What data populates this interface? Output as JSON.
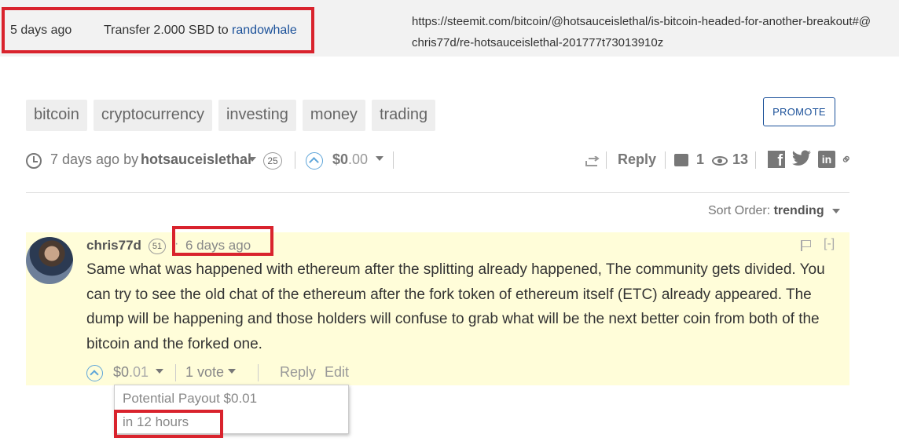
{
  "transfer": {
    "date": "5 days ago",
    "memo_prefix": "Transfer 2.000 SBD to",
    "recipient": "randowhale",
    "url": "https://steemit.com/bitcoin/@hotsauceislethal/is-bitcoin-headed-for-another-breakout#@chris77d/re-hotsauceislethal-201777t73013910z"
  },
  "tags": [
    "bitcoin",
    "cryptocurrency",
    "investing",
    "money",
    "trading"
  ],
  "promote_label": "PROMOTE",
  "post_meta": {
    "time": "7 days ago by",
    "author": "hotsauceislethal",
    "reputation": "25",
    "payout_main": "$0",
    "payout_cents": ".00",
    "reply_label": "Reply",
    "comments_count": "1",
    "views_count": "13"
  },
  "sort": {
    "label": "Sort Order:",
    "value": "trending"
  },
  "comment": {
    "author": "chris77d",
    "reputation": "51",
    "separator": "·",
    "time": "6 days ago",
    "collapse_label": "[-]",
    "body": "Same what was happened with ethereum after the splitting already happened, The community gets divided. You can try to see the old chat of the ethereum after the fork token of ethereum itself (ETC) already appeared. The dump will be happening and those holders will confuse to grab what will be the next better coin from both of the bitcoin and the forked one.",
    "payout_main": "$0",
    "payout_cents": ".01",
    "votes": "1 vote",
    "reply_label": "Reply",
    "edit_label": "Edit"
  },
  "tooltip": {
    "potential_payout": "Potential Payout $0.01",
    "time_remaining": "in 12 hours"
  },
  "colors": {
    "highlight_box": "#d9232d",
    "link": "#1a5099",
    "upvote": "#5ea5d9",
    "comment_bg": "#fffdd9"
  }
}
